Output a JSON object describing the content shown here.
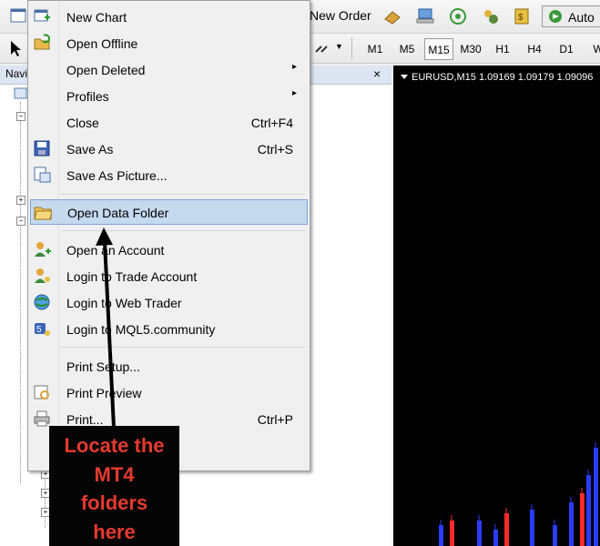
{
  "toolbar": {
    "new_order_label": "New Order",
    "auto_label": "Auto",
    "timeframes": [
      {
        "label": "M1",
        "active": false
      },
      {
        "label": "M5",
        "active": false
      },
      {
        "label": "M15",
        "active": true
      },
      {
        "label": "M30",
        "active": false
      },
      {
        "label": "H1",
        "active": false
      },
      {
        "label": "H4",
        "active": false
      },
      {
        "label": "D1",
        "active": false
      },
      {
        "label": "W",
        "active": false
      }
    ]
  },
  "navigator": {
    "title": "Navi",
    "close_glyph": "×"
  },
  "chart": {
    "title": "EURUSD,M15  1.09169 1.09179 1.09096",
    "colors": {
      "background": "#000000",
      "bull": "#2a3cff",
      "bear": "#ff2a2a"
    }
  },
  "file_menu": {
    "items": [
      {
        "label": "New Chart",
        "icon": "new-chart-icon",
        "shortcut": "",
        "submenu": false
      },
      {
        "label": "Open Offline",
        "icon": "open-offline-icon",
        "shortcut": "",
        "submenu": false
      },
      {
        "label": "Open Deleted",
        "icon": "",
        "shortcut": "",
        "submenu": true
      },
      {
        "label": "Profiles",
        "icon": "",
        "shortcut": "",
        "submenu": true
      },
      {
        "label": "Close",
        "icon": "",
        "shortcut": "Ctrl+F4",
        "submenu": false
      },
      {
        "label": "Save As",
        "icon": "save-icon",
        "shortcut": "Ctrl+S",
        "submenu": false
      },
      {
        "label": "Save As Picture...",
        "icon": "save-picture-icon",
        "shortcut": "",
        "submenu": false
      },
      {
        "label": "Open Data Folder",
        "icon": "folder-icon",
        "shortcut": "",
        "submenu": false,
        "highlighted": true
      },
      {
        "label": "Open an Account",
        "icon": "user-add-icon",
        "shortcut": "",
        "submenu": false
      },
      {
        "label": "Login to Trade Account",
        "icon": "user-login-icon",
        "shortcut": "",
        "submenu": false
      },
      {
        "label": "Login to Web Trader",
        "icon": "globe-icon",
        "shortcut": "",
        "submenu": false
      },
      {
        "label": "Login to MQL5.community",
        "icon": "mql5-icon",
        "shortcut": "",
        "submenu": false
      },
      {
        "label": "Print Setup...",
        "icon": "",
        "shortcut": "",
        "submenu": false
      },
      {
        "label": "Print Preview",
        "icon": "print-preview-icon",
        "shortcut": "",
        "submenu": false
      },
      {
        "label": "Print...",
        "icon": "printer-icon",
        "shortcut": "Ctrl+P",
        "submenu": false
      }
    ],
    "submenu_glyph": "▸"
  },
  "annotation": {
    "lines": [
      "Locate the",
      "MT4",
      "folders",
      "here"
    ],
    "text_color": "#e53a2e",
    "box_color": "#050505"
  }
}
